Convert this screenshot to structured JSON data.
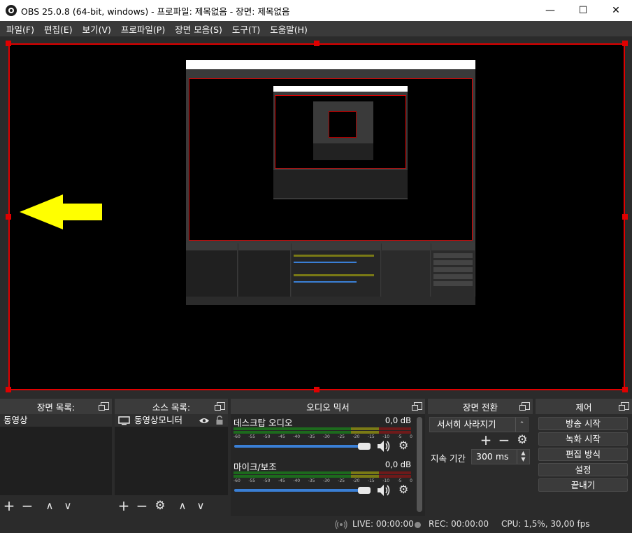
{
  "window": {
    "title": "OBS 25.0.8 (64-bit, windows) - 프로파일: 제목없음 - 장면: 제목없음",
    "min_glyph": "—",
    "max_glyph": "☐",
    "close_glyph": "✕"
  },
  "menu": [
    "파일(F)",
    "편집(E)",
    "보기(V)",
    "프로파일(P)",
    "장면 모음(S)",
    "도구(T)",
    "도움말(H)"
  ],
  "colors": {
    "selection_border": "#e00000",
    "arrow": "#ffff00",
    "slider": "#3a7fd5"
  },
  "docks": {
    "scenes": {
      "title": "장면 목록:",
      "items": [
        "동영상"
      ]
    },
    "sources": {
      "title": "소스 목록:",
      "items": [
        {
          "name": "동영상모니터",
          "icon": "monitor-icon"
        }
      ]
    },
    "mixer": {
      "title": "오디오 믹서",
      "channels": [
        {
          "name": "데스크탑 오디오",
          "db": "0,0 dB",
          "level": 0.95
        },
        {
          "name": "마이크/보조",
          "db": "0,0 dB",
          "level": 0.95
        }
      ],
      "ticks": [
        "-60",
        "-55",
        "-50",
        "-45",
        "-40",
        "-35",
        "-30",
        "-25",
        "-20",
        "-15",
        "-10",
        "-5",
        "0"
      ]
    },
    "transitions": {
      "title": "장면 전환",
      "selected": "서서히 사라지기",
      "duration_label": "지속 기간",
      "duration_value": "300 ms"
    },
    "controls": {
      "title": "제어",
      "buttons": [
        "방송 시작",
        "녹화 시작",
        "편집 방식",
        "설정",
        "끝내기"
      ]
    }
  },
  "toolbar_glyphs": {
    "add": "+",
    "remove": "−",
    "up": "∧",
    "down": "∨",
    "gear": "⚙"
  },
  "status": {
    "live": "LIVE: 00:00:00",
    "rec": "REC: 00:00:00",
    "cpu": "CPU: 1,5%, 30,00 fps"
  }
}
